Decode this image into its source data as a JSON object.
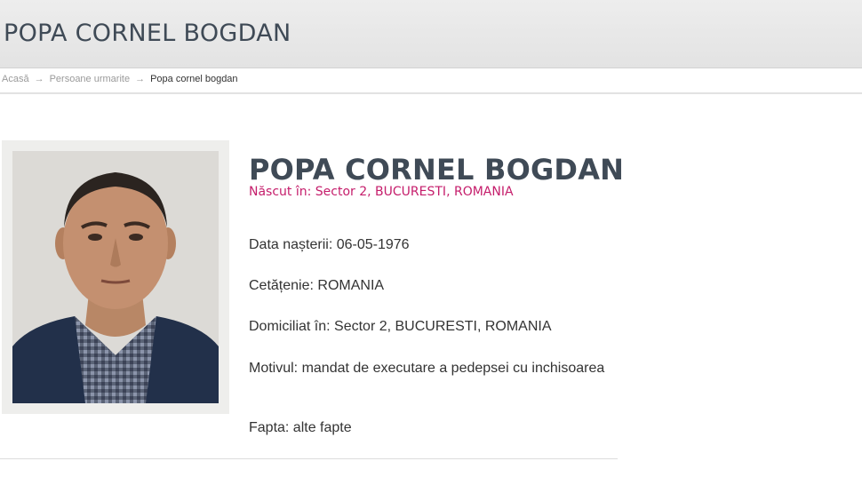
{
  "header": {
    "title": "POPA CORNEL BOGDAN"
  },
  "breadcrumb": {
    "home": "Acasă",
    "section": "Persoane urmarite",
    "current": "Popa cornel bogdan",
    "separator": "→"
  },
  "person": {
    "name": "POPA CORNEL BOGDAN",
    "birthplace": "Născut în: Sector 2, BUCURESTI, ROMANIA",
    "birth_date": "Data nașterii: 06-05-1976",
    "citizenship": "Cetățenie: ROMANIA",
    "domicile": "Domiciliat în: Sector 2, BUCURESTI, ROMANIA",
    "reason": "Motivul: mandat de executare a pedepsei cu inchisoarea",
    "deed": "Fapta: alte fapte"
  },
  "colors": {
    "title": "#3f4a56",
    "accent": "#c51d6b",
    "header_bg": "#e6e6e6"
  }
}
